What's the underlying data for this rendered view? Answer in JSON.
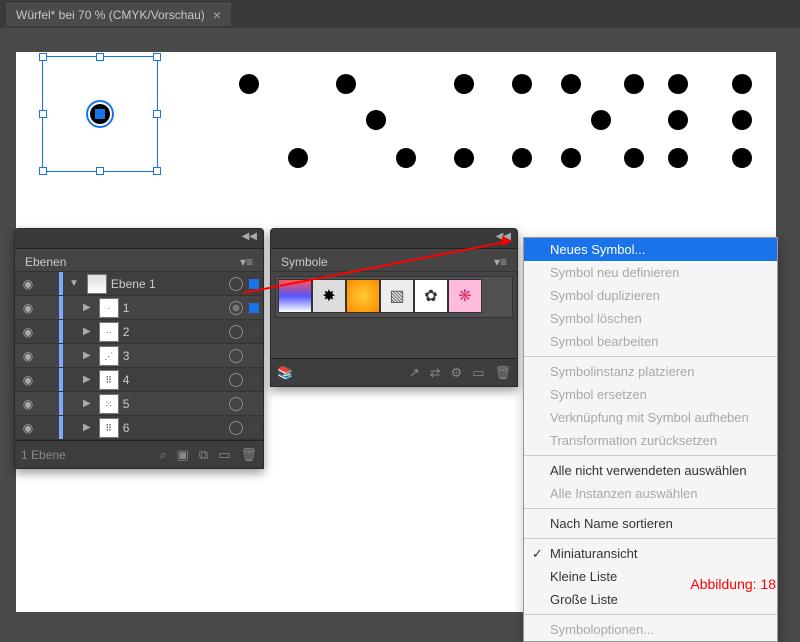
{
  "document": {
    "tab_label": "Würfel* bei 70 % (CMYK/Vorschau)"
  },
  "layers_panel": {
    "title": "Ebenen",
    "parent_layer": "Ebene 1",
    "items": [
      {
        "name": "1"
      },
      {
        "name": "2"
      },
      {
        "name": "3"
      },
      {
        "name": "4"
      },
      {
        "name": "5"
      },
      {
        "name": "6"
      }
    ],
    "footer_count": "1 Ebene"
  },
  "symbols_panel": {
    "title": "Symbole"
  },
  "menu": {
    "new_symbol": "Neues Symbol...",
    "redefine": "Symbol neu definieren",
    "duplicate": "Symbol duplizieren",
    "delete": "Symbol löschen",
    "edit": "Symbol bearbeiten",
    "place_instance": "Symbolinstanz platzieren",
    "replace": "Symbol ersetzen",
    "break_link": "Verknüpfung mit Symbol aufheben",
    "reset_transform": "Transformation zurücksetzen",
    "select_unused": "Alle nicht verwendeten auswählen",
    "select_instances": "Alle Instanzen auswählen",
    "sort_name": "Nach Name sortieren",
    "thumb_view": "Miniaturansicht",
    "small_list": "Kleine Liste",
    "large_list": "Große Liste",
    "options": "Symboloptionen..."
  },
  "caption": "Abbildung: 18"
}
